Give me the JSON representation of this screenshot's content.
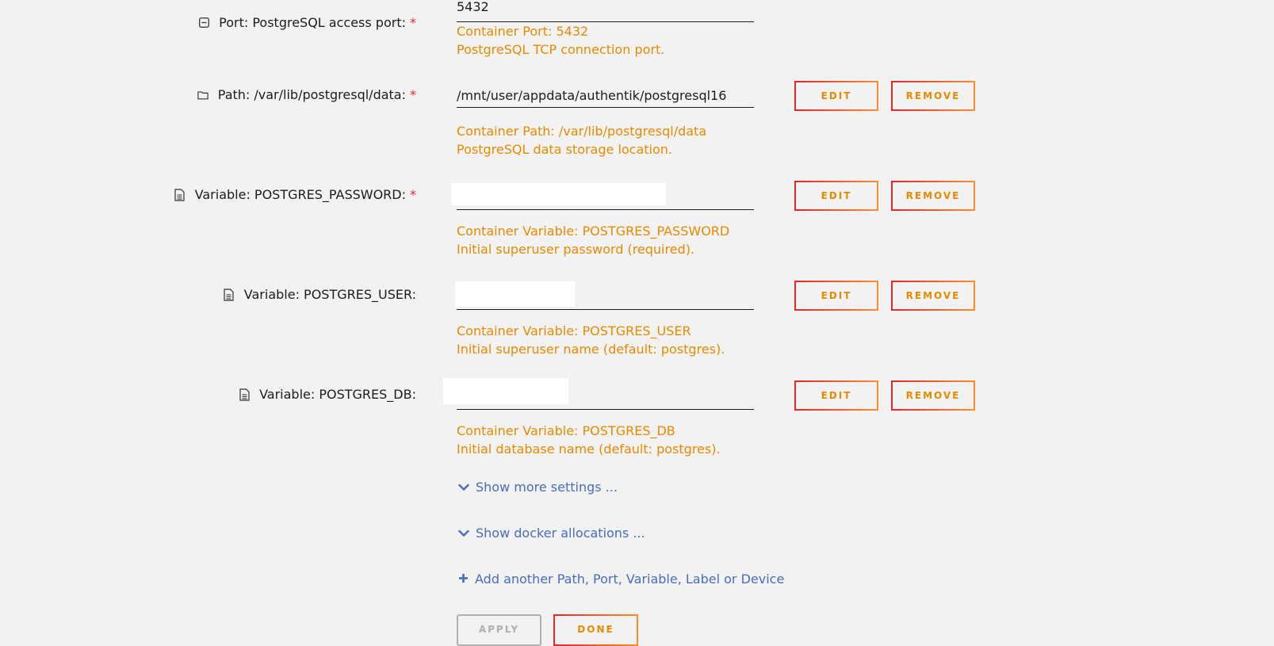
{
  "port": {
    "label": "Port: PostgreSQL access port:",
    "required_mark": "*",
    "icon": "minus-square-icon",
    "value": "5432",
    "desc_line1": "Container Port: 5432",
    "desc_line2": "PostgreSQL TCP connection port."
  },
  "path": {
    "label": "Path: /var/lib/postgresql/data:",
    "required_mark": "*",
    "icon": "folder-icon",
    "value": "/mnt/user/appdata/authentik/postgresql16",
    "desc_line1": "Container Path: /var/lib/postgresql/data",
    "desc_line2": "PostgreSQL data storage location.",
    "edit_label": "EDIT",
    "remove_label": "REMOVE"
  },
  "var_password": {
    "label": "Variable: POSTGRES_PASSWORD:",
    "required_mark": "*",
    "icon": "file-icon",
    "value": "",
    "desc_line1": "Container Variable: POSTGRES_PASSWORD",
    "desc_line2": "Initial superuser password (required).",
    "edit_label": "EDIT",
    "remove_label": "REMOVE"
  },
  "var_user": {
    "label": "Variable: POSTGRES_USER:",
    "icon": "file-icon",
    "value": "",
    "desc_line1": "Container Variable: POSTGRES_USER",
    "desc_line2": "Initial superuser name (default: postgres).",
    "edit_label": "EDIT",
    "remove_label": "REMOVE"
  },
  "var_db": {
    "label": "Variable: POSTGRES_DB:",
    "icon": "file-icon",
    "value": "",
    "desc_line1": "Container Variable: POSTGRES_DB",
    "desc_line2": "Initial database name (default: postgres).",
    "edit_label": "EDIT",
    "remove_label": "REMOVE"
  },
  "links": {
    "show_more": "Show more settings ...",
    "show_docker": "Show docker allocations ...",
    "add_another": "Add another Path, Port, Variable, Label or Device"
  },
  "actions": {
    "apply_label": "APPLY",
    "done_label": "DONE"
  },
  "colors": {
    "accent_orange": "#e68a00",
    "link_blue": "#486dba",
    "required_red": "#e22828",
    "background": "#f2f2f2"
  }
}
